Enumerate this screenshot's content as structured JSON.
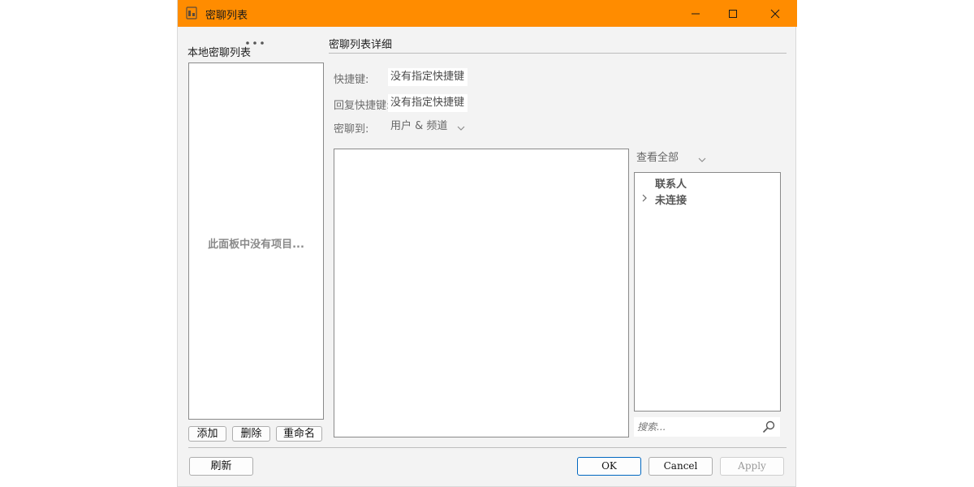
{
  "window": {
    "title": "密聊列表",
    "accent_color": "#ff8c00",
    "controls": {
      "minimize_icon": "minimize-icon",
      "maximize_icon": "maximize-icon",
      "close_icon": "close-icon"
    }
  },
  "left_panel": {
    "title": "本地密聊列表",
    "more_icon": "ellipsis-icon",
    "empty_text": "此面板中没有项目...",
    "buttons": {
      "add": "添加",
      "delete": "删除",
      "rename": "重命名"
    }
  },
  "right_panel": {
    "title": "密聊列表详细",
    "shortcut": {
      "label": "快捷键:",
      "value": "没有指定快捷键"
    },
    "reply_shortcut": {
      "label": "回复快捷键:",
      "value": "没有指定快捷键"
    },
    "whisper_to": {
      "label": "密聊到:",
      "selected": "用户 & 频道"
    },
    "view_filter": {
      "selected": "查看全部"
    },
    "tree": [
      {
        "label": "联系人",
        "expandable": false
      },
      {
        "label": "未连接",
        "expandable": true
      }
    ],
    "search": {
      "placeholder": "搜索..."
    }
  },
  "footer": {
    "refresh": "刷新",
    "ok": "OK",
    "cancel": "Cancel",
    "apply": "Apply"
  }
}
